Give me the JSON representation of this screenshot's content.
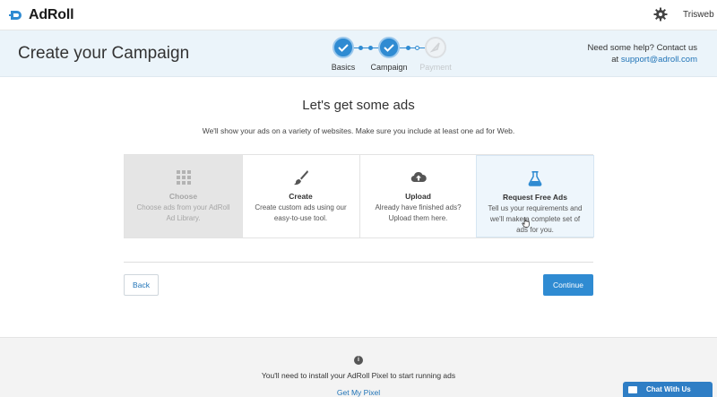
{
  "nav": {
    "logo_text": "AdRoll",
    "user_name": "Trisweb",
    "settings_icon": "gear-icon"
  },
  "header": {
    "title": "Create your Campaign",
    "help_line1": "Need some help? Contact us",
    "help_prefix": "at",
    "help_email": "support@adroll.com"
  },
  "stepper": {
    "steps": [
      {
        "label": "Basics",
        "state": "done"
      },
      {
        "label": "Campaign",
        "state": "done"
      },
      {
        "label": "Payment",
        "state": "pending"
      }
    ]
  },
  "main": {
    "title": "Let's get some ads",
    "subtitle": "We'll show your ads on a variety of websites. Make sure you include at least one ad for Web.",
    "options": [
      {
        "title": "Choose",
        "desc": "Choose ads from your AdRoll Ad Library.",
        "icon": "grid-icon",
        "state": "disabled"
      },
      {
        "title": "Create",
        "desc": "Create custom ads using our easy-to-use tool.",
        "icon": "paintbrush-icon",
        "state": "normal"
      },
      {
        "title": "Upload",
        "desc": "Already have finished ads? Upload them here.",
        "icon": "cloud-upload-icon",
        "state": "normal"
      },
      {
        "title": "Request Free Ads",
        "desc": "Tell us your requirements and we'll make a complete set of ads for you.",
        "icon": "flask-icon",
        "state": "selected"
      }
    ],
    "back_label": "Back",
    "continue_label": "Continue"
  },
  "footer": {
    "message": "You'll need to install your AdRoll Pixel to start running ads",
    "link": "Get My Pixel"
  },
  "chat": {
    "label": "Chat With Us"
  },
  "colors": {
    "accent": "#2f8bd2",
    "link": "#1f73b7",
    "header_bg": "#ebf4fa"
  }
}
